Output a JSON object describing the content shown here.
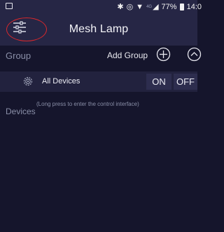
{
  "status_bar": {
    "battery": "77%",
    "network": "4G",
    "time": "14:0",
    "icons": [
      "notification-icon",
      "bluetooth-icon",
      "do-not-disturb-icon",
      "wifi-icon",
      "cell-signal-icon",
      "battery-icon"
    ]
  },
  "app_bar": {
    "title": "Mesh Lamp",
    "menu_icon": "settings-sliders-icon",
    "highlight_color": "#d8282c"
  },
  "group_section": {
    "label": "Group",
    "add_group_label": "Add Group",
    "add_icon": "plus-circle-icon",
    "collapse_icon": "chevron-up-circle-icon"
  },
  "all_devices": {
    "icon": "gear-icon",
    "label": "All Devices",
    "on_label": "ON",
    "off_label": "OFF"
  },
  "devices_section": {
    "label": "Devices",
    "hint": "(Long press to enter the control interface)"
  },
  "colors": {
    "background": "#15152c",
    "bar": "#262645",
    "row": "#22223e",
    "button": "#2d2d4e",
    "muted_text": "#8a8fa8"
  }
}
